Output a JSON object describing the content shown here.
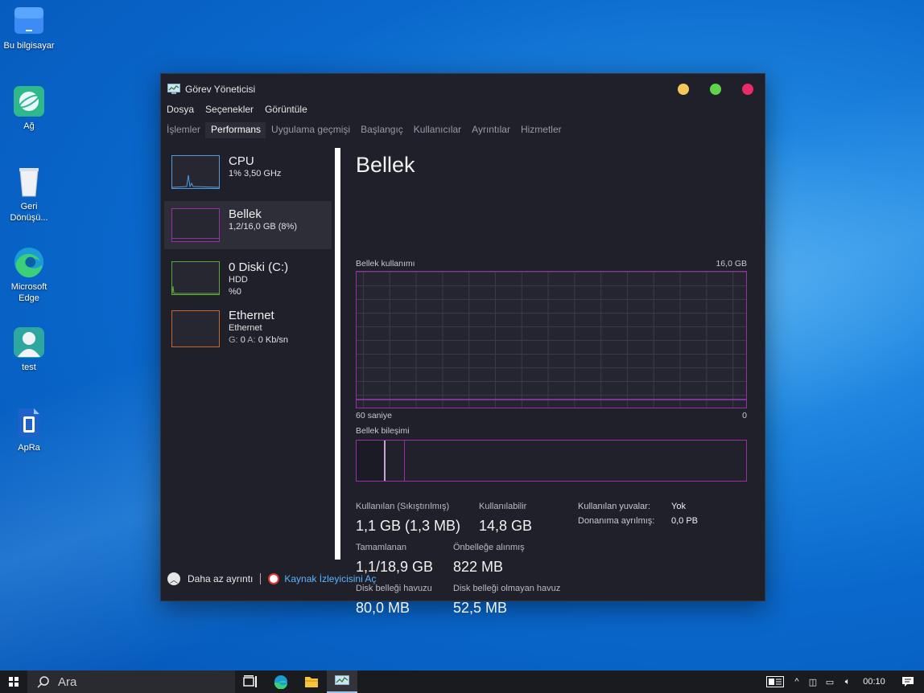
{
  "desktop": {
    "icons": [
      {
        "label": "Bu bilgisayar"
      },
      {
        "label": "Ağ"
      },
      {
        "label": "Geri Dönüşü..."
      },
      {
        "label": "Microsoft Edge"
      },
      {
        "label": "test"
      },
      {
        "label": "ApRa"
      }
    ]
  },
  "window": {
    "title": "Görev Yöneticisi",
    "controls": {
      "minimize_color": "#f5c75a",
      "maximize_color": "#5fd34b",
      "close_color": "#ea2a6b"
    },
    "menu": [
      "Dosya",
      "Seçenekler",
      "Görüntüle"
    ],
    "tabs": [
      "İşlemler",
      "Performans",
      "Uygulama geçmişi",
      "Başlangıç",
      "Kullanıcılar",
      "Ayrıntılar",
      "Hizmetler"
    ],
    "active_tab": "Performans"
  },
  "sidebar": {
    "items": [
      {
        "name": "CPU",
        "line1": "1%  3,50 GHz",
        "line2": "",
        "line3": "",
        "color": "#4f9bdc"
      },
      {
        "name": "Bellek",
        "line1": "1,2/16,0 GB (8%)",
        "line2": "",
        "line3": "",
        "color": "#9a2ea8"
      },
      {
        "name": "0 Diski (C:)",
        "line1": "HDD",
        "line2": "%0",
        "line3": "",
        "color": "#5ba832"
      },
      {
        "name": "Ethernet",
        "line1": "Ethernet",
        "line2_prefix_g": "G:",
        "line2_g": "0",
        "line2_prefix_a": "A:",
        "line2_a": "0 Kb/sn",
        "color": "#c8672c"
      }
    ],
    "active": "Bellek"
  },
  "main": {
    "title": "Bellek",
    "usage_label": "Bellek kullanımı",
    "usage_max": "16,0 GB",
    "time_left": "60 saniye",
    "time_right": "0",
    "composition_label": "Bellek bileşimi",
    "stats": {
      "used_label": "Kullanılan (Sıkıştırılmış)",
      "used_value": "1,1 GB (1,3 MB)",
      "available_label": "Kullanılabilir",
      "available_value": "14,8 GB",
      "committed_label": "Tamamlanan",
      "committed_value": "1,1/18,9 GB",
      "cached_label": "Önbelleğe alınmış",
      "cached_value": "822 MB",
      "paged_label": "Disk belleği havuzu",
      "paged_value": "80,0 MB",
      "nonpaged_label": "Disk belleği olmayan havuz",
      "nonpaged_value": "52,5 MB",
      "slots_label": "Kullanılan yuvalar:",
      "slots_value": "Yok",
      "reserved_label": "Donanıma ayrılmış:",
      "reserved_value": "0,0 PB"
    }
  },
  "footer": {
    "fewer_details": "Daha az ayrıntı",
    "resource_monitor": "Kaynak İzleyicisini Aç"
  },
  "taskbar": {
    "search_placeholder": "Ara",
    "time": "00:10"
  }
}
